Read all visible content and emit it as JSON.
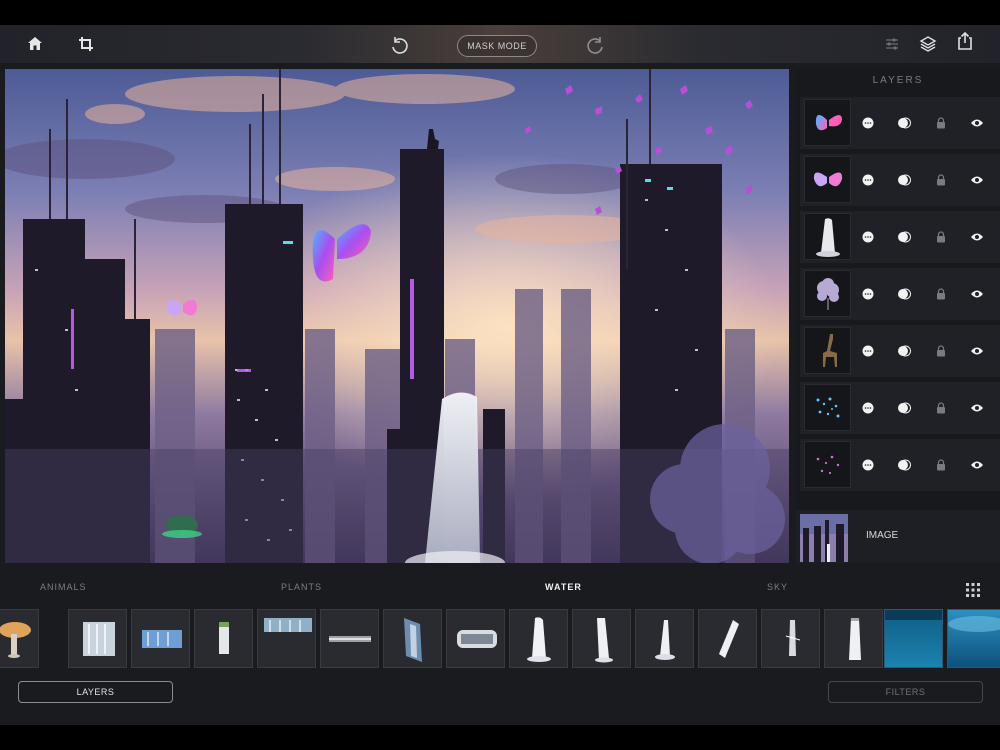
{
  "toolbar": {
    "mask_mode_label": "MASK MODE",
    "icons": [
      "home-icon",
      "crop-icon",
      "undo-icon",
      "redo-icon",
      "sliders-icon",
      "layers-icon",
      "share-icon"
    ]
  },
  "layers_panel": {
    "title": "LAYERS",
    "layers": [
      {
        "thumb": "blue-butterfly"
      },
      {
        "thumb": "pink-butterfly"
      },
      {
        "thumb": "waterfall"
      },
      {
        "thumb": "tree"
      },
      {
        "thumb": "giraffe"
      },
      {
        "thumb": "blue-particles"
      },
      {
        "thumb": "purple-particles"
      }
    ],
    "base_label": "IMAGE"
  },
  "categories": {
    "items": [
      "ANIMALS",
      "PLANTS",
      "WATER",
      "SKY"
    ],
    "active": "WATER"
  },
  "bottom": {
    "layers_label": "LAYERS",
    "filters_label": "FILTERS"
  },
  "colors": {
    "accent": "#ffffff",
    "panel_bg": "#18191c",
    "app_bg": "#1a1b1f"
  }
}
